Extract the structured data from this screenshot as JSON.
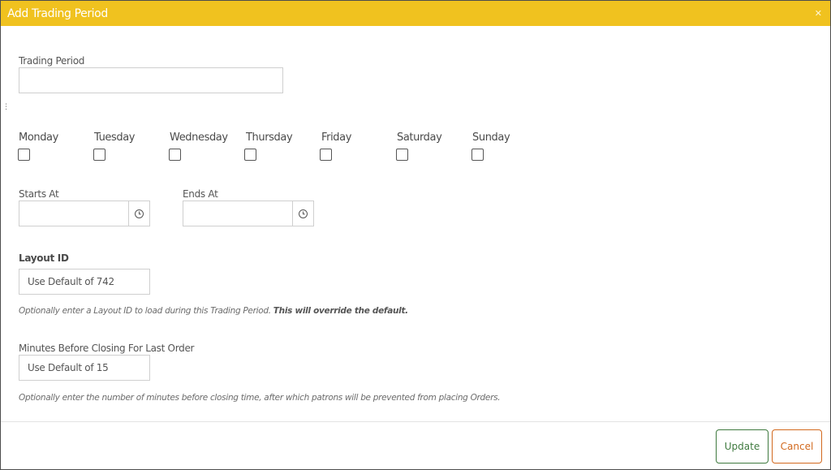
{
  "dialog": {
    "title": "Add Trading Period",
    "close_icon": "close-icon"
  },
  "trading_period": {
    "label": "Trading Period",
    "value": ""
  },
  "days": [
    {
      "label": "Monday",
      "checked": false
    },
    {
      "label": "Tuesday",
      "checked": false
    },
    {
      "label": "Wednesday",
      "checked": false
    },
    {
      "label": "Thursday",
      "checked": false
    },
    {
      "label": "Friday",
      "checked": false
    },
    {
      "label": "Saturday",
      "checked": false
    },
    {
      "label": "Sunday",
      "checked": false
    }
  ],
  "starts_at": {
    "label": "Starts At",
    "value": "",
    "icon": "clock-icon"
  },
  "ends_at": {
    "label": "Ends At",
    "value": "",
    "icon": "clock-icon"
  },
  "layout_id": {
    "label": "Layout ID",
    "placeholder": "Use Default of 742",
    "help_text": "Optionally enter a Layout ID to load during this Trading Period.",
    "help_strong": "This will override the default."
  },
  "minutes_before_closing": {
    "label": "Minutes Before Closing For Last Order",
    "placeholder": "Use Default of 15",
    "help_text": "Optionally enter the number of minutes before closing time, after which patrons will be prevented from placing Orders."
  },
  "footer": {
    "update_label": "Update",
    "cancel_label": "Cancel"
  },
  "colors": {
    "title_bar": "#f0c21f",
    "update_border": "#3f7a3f",
    "cancel_border": "#d2691e"
  }
}
